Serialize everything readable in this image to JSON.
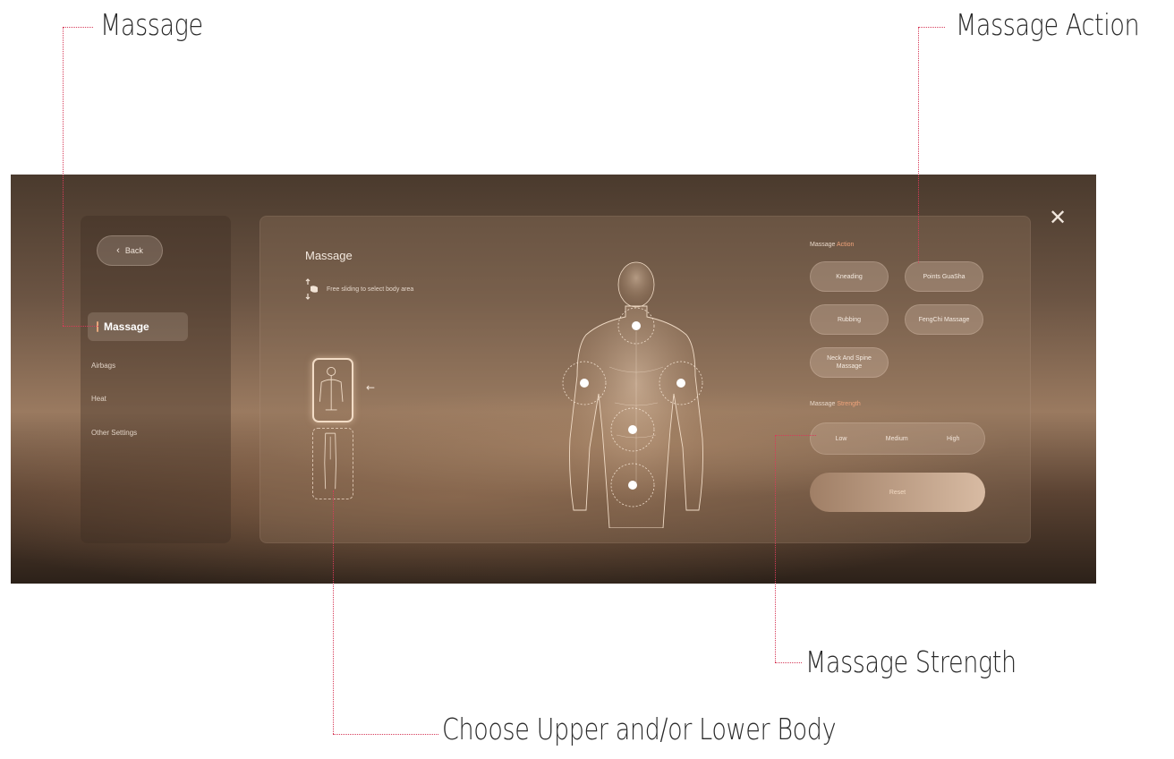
{
  "callouts": {
    "massage": "Massage",
    "massage_action": "Massage Action",
    "massage_strength": "Massage Strength",
    "choose_body": "Choose Upper and/or Lower Body"
  },
  "colors": {
    "callout_line": "#d63c5a",
    "accent": "#e7a87c",
    "label_accent": "#f0a37a"
  },
  "screen": {
    "close_icon": "close-icon",
    "sidebar": {
      "back_label": "Back",
      "items": [
        {
          "label": "Massage",
          "active": true
        },
        {
          "label": "Airbags",
          "active": false
        },
        {
          "label": "Heat",
          "active": false
        },
        {
          "label": "Other Settings",
          "active": false
        }
      ]
    },
    "panel": {
      "title": "Massage",
      "hint": "Free sliding to select body area",
      "massage_action": {
        "label_prefix": "Massage",
        "label_accent": "Action",
        "options": [
          "Kneading",
          "Points GuaSha",
          "Rubbing",
          "FengChi Massage",
          "Neck And Spine Massage"
        ]
      },
      "massage_strength": {
        "label_prefix": "Massage",
        "label_accent": "Strength",
        "options": [
          "Low",
          "Medium",
          "High"
        ]
      },
      "reset_label": "Reset"
    }
  }
}
